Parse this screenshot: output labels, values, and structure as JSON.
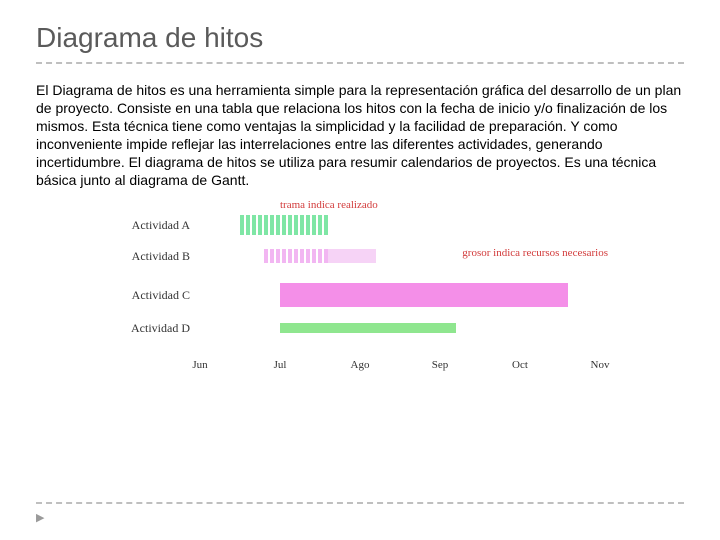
{
  "title": "Diagrama de hitos",
  "body": "El Diagrama de hitos es una herramienta simple para la representación gráfica del desarrollo de un plan de proyecto. Consiste en una tabla que relaciona los hitos con la fecha de inicio y/o finalización de los mismos. Esta técnica tiene como ventajas la simplicidad y la facilidad de preparación. Y como inconveniente impide reflejar las interrelaciones entre las diferentes actividades, generando incertidumbre.\nEl diagrama de hitos se utiliza para resumir calendarios de proyectos. Es una técnica básica junto al diagrama de Gantt.",
  "legends": {
    "top": "trama indica realizado",
    "side": "grosor indica recursos necesarios"
  },
  "chart_data": {
    "type": "bar",
    "orientation": "horizontal",
    "xlabel": "",
    "ylabel": "",
    "x_categories": [
      "Jun",
      "Jul",
      "Ago",
      "Sep",
      "Oct",
      "Nov"
    ],
    "x_range_months": [
      6,
      11
    ],
    "series": [
      {
        "name": "Actividad A",
        "start": 6.5,
        "end": 7.6,
        "done_end": 7.6,
        "thickness": 20,
        "colors": {
          "done": "#7fe6a5",
          "remaining": "#b0eac2"
        }
      },
      {
        "name": "Actividad B",
        "start": 6.8,
        "end": 8.2,
        "done_end": 7.6,
        "thickness": 14,
        "colors": {
          "done": "#f2b6f2",
          "remaining": "#f6d3f6"
        }
      },
      {
        "name": "Actividad C",
        "start": 7.0,
        "end": 10.6,
        "done_end": 7.0,
        "thickness": 24,
        "colors": {
          "done": "#f48fe8",
          "remaining": "#f48fe8"
        }
      },
      {
        "name": "Actividad D",
        "start": 7.0,
        "end": 9.2,
        "done_end": 7.0,
        "thickness": 10,
        "colors": {
          "done": "#8fe68f",
          "remaining": "#8fe68f"
        }
      }
    ],
    "annotations": [
      "trama indica realizado",
      "grosor indica recursos necesarios"
    ]
  }
}
